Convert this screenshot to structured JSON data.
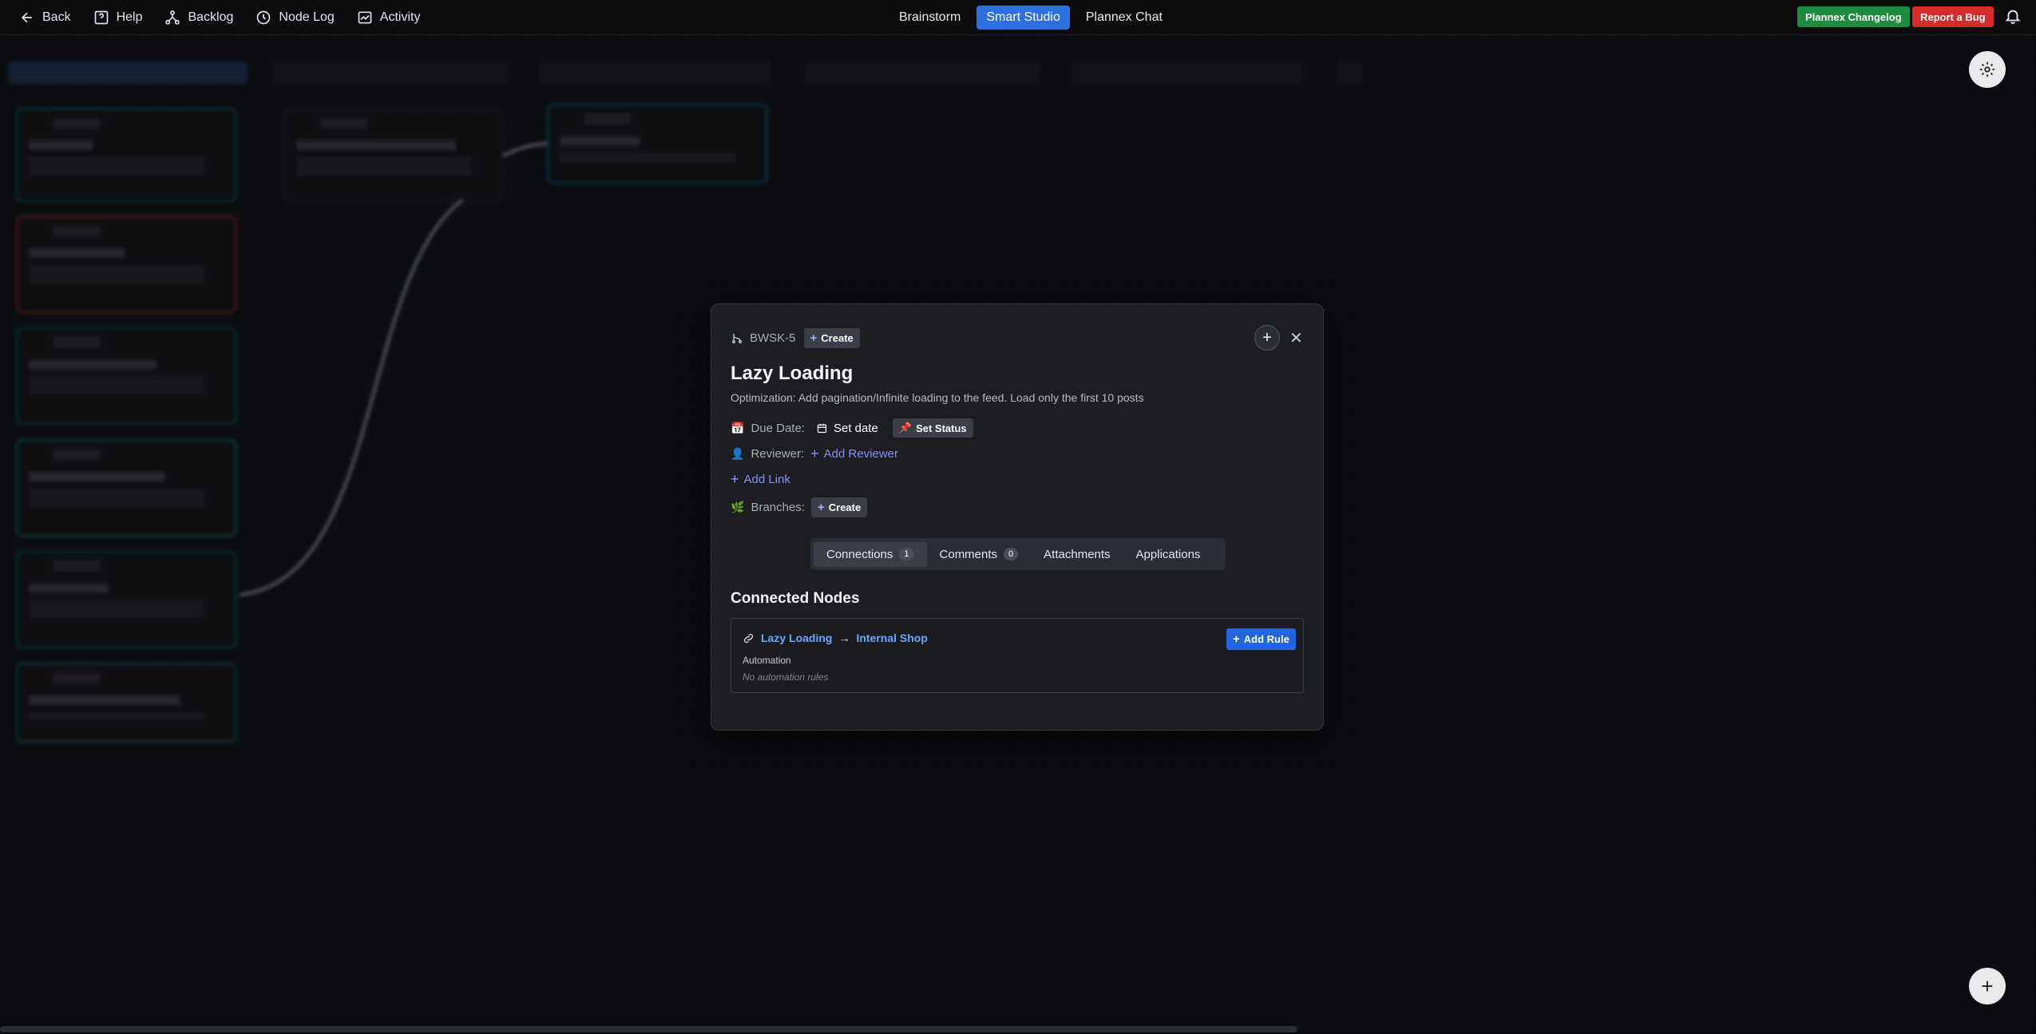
{
  "topbar": {
    "back": "Back",
    "help": "Help",
    "backlog": "Backlog",
    "node_log": "Node Log",
    "activity": "Activity",
    "tabs": [
      "Brainstorm",
      "Smart Studio",
      "Plannex Chat"
    ],
    "active_tab": "Smart Studio",
    "changelog": "Plannex Changelog",
    "report_bug": "Report a Bug"
  },
  "modal": {
    "node_id": "BWSK-5",
    "create_label": "Create",
    "title": "Lazy Loading",
    "description": "Optimization: Add pagination/Infinite loading to the feed. Load only the first 10 posts",
    "due_date_label": "Due Date:",
    "set_date": "Set date",
    "set_status": "Set Status",
    "reviewer_label": "Reviewer:",
    "add_reviewer": "Add Reviewer",
    "add_link": "Add Link",
    "branches_label": "Branches:",
    "branches_create": "Create",
    "tabs": [
      {
        "label": "Connections",
        "count": "1"
      },
      {
        "label": "Comments",
        "count": "0"
      },
      {
        "label": "Attachments",
        "count": null
      },
      {
        "label": "Applications",
        "count": null
      }
    ],
    "connected_nodes_title": "Connected Nodes",
    "connection": {
      "from": "Lazy Loading",
      "arrow": "→",
      "to": "Internal Shop",
      "add_rule": "Add Rule",
      "automation_label": "Automation",
      "automation_empty": "No automation rules"
    }
  },
  "colors": {
    "accent": "#2f6fe0",
    "changelog": "#1f8b3e",
    "bug": "#d42b2b",
    "link": "#6aa8ff"
  }
}
